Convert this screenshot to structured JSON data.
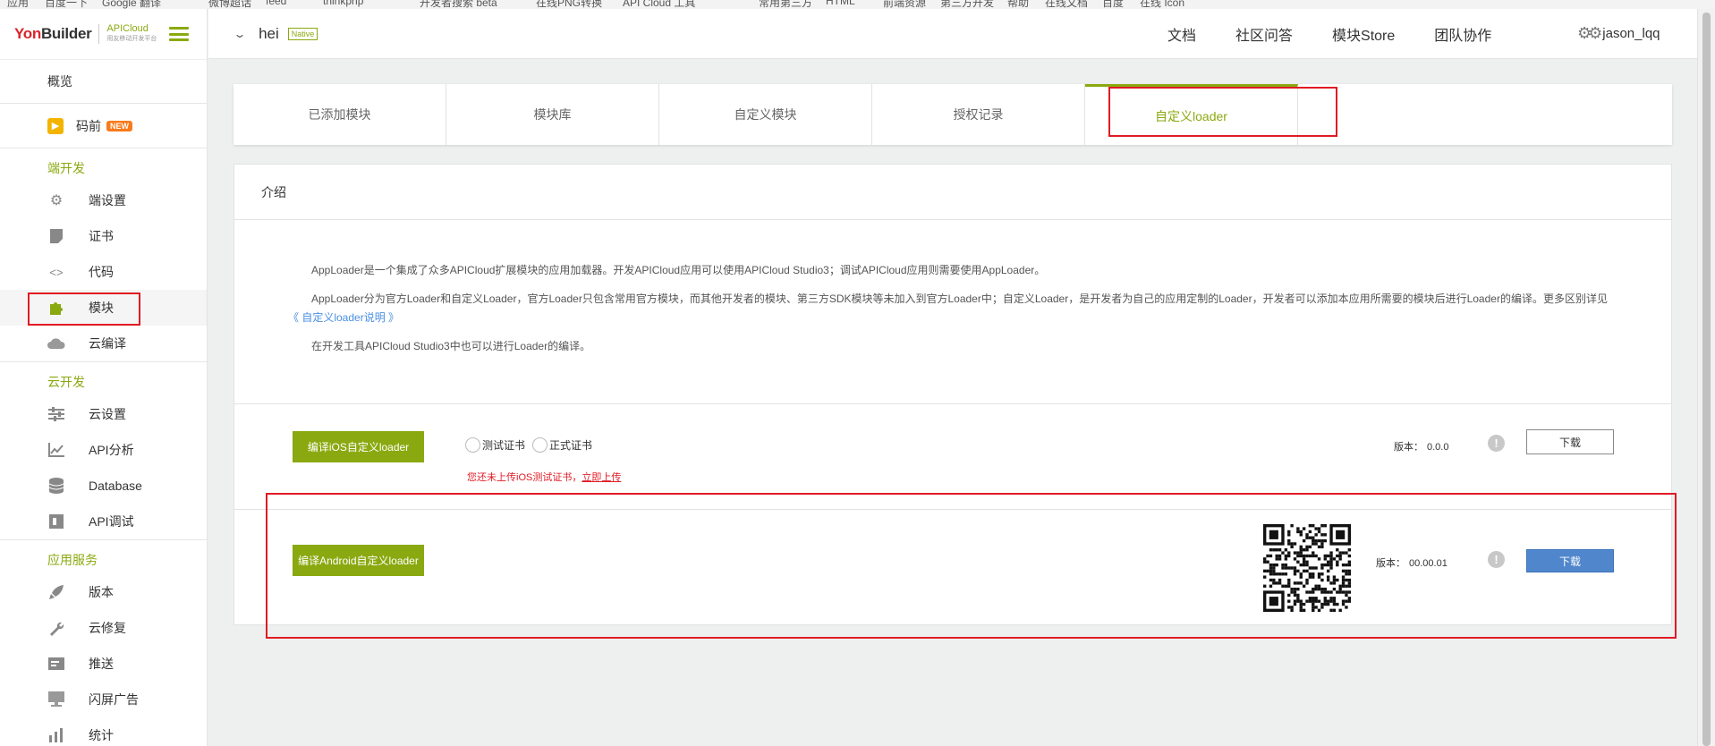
{
  "browser": {
    "bookmarks": [
      "应用",
      "百度一下",
      "Google 翻译",
      "微博超话",
      "feed",
      "thinkphp",
      "开发者搜索 beta",
      "在线PNG转换",
      "API Cloud 工具",
      "常用第三方",
      "HTML",
      "前端资源",
      "第三方开发",
      "帮助",
      "在线文档",
      "百度",
      "在线 Icon"
    ]
  },
  "sidebar": {
    "logo": {
      "brand_red": "Yon",
      "brand_dark": "Builder",
      "sub_title": "APICloud",
      "sub_caption": "用友移动开发平台"
    },
    "overview": "概览",
    "maqian": {
      "label": "码前",
      "badge": "NEW"
    },
    "sections": [
      {
        "title": "端开发",
        "items": [
          {
            "label": "端设置",
            "icon": "gear-icon"
          },
          {
            "label": "证书",
            "icon": "certificate-icon"
          },
          {
            "label": "代码",
            "icon": "code-icon"
          },
          {
            "label": "模块",
            "icon": "puzzle-icon",
            "active": true
          },
          {
            "label": "云编译",
            "icon": "cloud-icon"
          }
        ]
      },
      {
        "title": "云开发",
        "items": [
          {
            "label": "云设置",
            "icon": "sliders-icon"
          },
          {
            "label": "API分析",
            "icon": "chart-icon"
          },
          {
            "label": "Database",
            "icon": "database-icon"
          },
          {
            "label": "API调试",
            "icon": "debug-icon"
          }
        ]
      },
      {
        "title": "应用服务",
        "items": [
          {
            "label": "版本",
            "icon": "rocket-icon"
          },
          {
            "label": "云修复",
            "icon": "wrench-icon"
          },
          {
            "label": "推送",
            "icon": "push-icon"
          },
          {
            "label": "闪屏广告",
            "icon": "ad-icon"
          },
          {
            "label": "统计",
            "icon": "stats-icon"
          }
        ]
      }
    ]
  },
  "header": {
    "app_name": "hei",
    "app_tag": "Native",
    "links": [
      "文档",
      "社区问答",
      "模块Store",
      "团队协作"
    ],
    "user": "jason_lqq"
  },
  "tabs": [
    "已添加模块",
    "模块库",
    "自定义模块",
    "授权记录",
    "自定义loader"
  ],
  "active_tab": "自定义loader",
  "intro": {
    "title": "介绍",
    "p1": "AppLoader是一个集成了众多APICloud扩展模块的应用加载器。开发APICloud应用可以使用APICloud Studio3；调试APICloud应用则需要使用AppLoader。",
    "p2": "AppLoader分为官方Loader和自定义Loader，官方Loader只包含常用官方模块，而其他开发者的模块、第三方SDK模块等未加入到官方Loader中；自定义Loader，是开发者为自己的应用定制的Loader，开发者可以添加本应用所需要的模块后进行Loader的编译。更多区别详见",
    "p2_link": "《 自定义loader说明 》",
    "p3": "在开发工具APICloud Studio3中也可以进行Loader的编译。"
  },
  "ios": {
    "compile_button": "编译iOS自定义loader",
    "radio_test": "测试证书",
    "radio_prod": "正式证书",
    "warning_text": "您还未上传iOS测试证书，",
    "warning_link": "立即上传",
    "version_label": "版本：",
    "version": "0.0.0",
    "download": "下载"
  },
  "android": {
    "compile_button": "编译Android自定义loader",
    "version_label": "版本：",
    "version": "00.00.01",
    "download": "下载"
  },
  "colors": {
    "accent": "#8aa910",
    "brand_red": "#d8262c",
    "highlight_red": "#e01b24",
    "download_blue": "#4f86cc"
  }
}
